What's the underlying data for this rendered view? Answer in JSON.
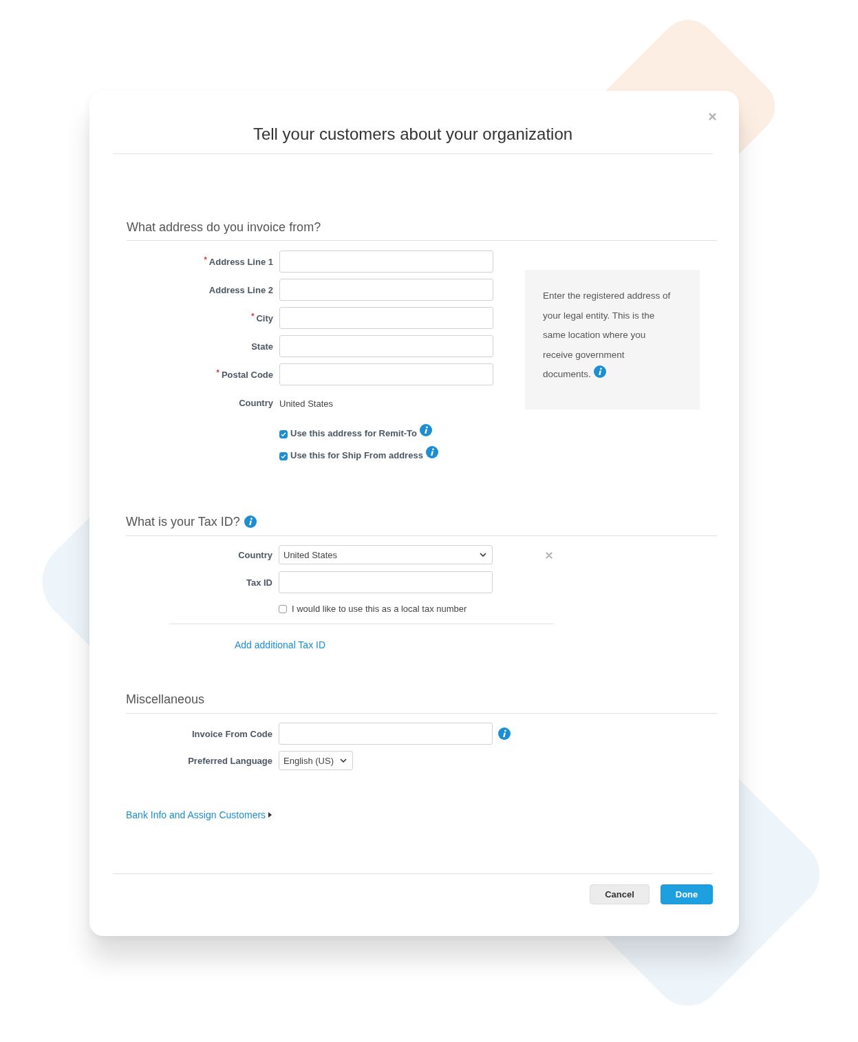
{
  "dialog": {
    "title": "Tell your customers about your organization",
    "address": {
      "heading": "What address do you invoice from?",
      "fields": [
        {
          "label": "Address Line 1",
          "required_mark": "*",
          "kind": "input"
        },
        {
          "label": "Address Line 2",
          "kind": "input"
        },
        {
          "label": "City",
          "required_mark": "*",
          "kind": "input"
        },
        {
          "label": "State",
          "kind": "input"
        },
        {
          "label": "Postal Code",
          "required_mark": "*",
          "kind": "input"
        },
        {
          "label": "Country",
          "kind": "text",
          "value": "United States"
        }
      ],
      "checkboxes": [
        {
          "label": "Use this address for Remit-To",
          "checked": true,
          "info": true
        },
        {
          "label": "Use this for Ship From address",
          "checked": true,
          "info": true
        }
      ],
      "help": {
        "text": "Enter the registered address of your legal entity. This is the same location where you receive government documents.",
        "info": true
      }
    },
    "tax": {
      "heading": "What is your Tax ID?",
      "info": true,
      "fields": [
        {
          "label": "Country",
          "kind": "select",
          "value": "United States",
          "removable": true
        },
        {
          "label": "Tax ID",
          "kind": "input"
        }
      ],
      "local_checkbox": {
        "label": "I would like to use this as a local tax number",
        "checked": false
      },
      "add_link": "Add additional Tax ID"
    },
    "misc": {
      "heading": "Miscellaneous",
      "fields": [
        {
          "label": "Invoice From Code",
          "kind": "input",
          "info": true
        },
        {
          "label": "Preferred Language",
          "kind": "select",
          "value": "English (US)",
          "compact": true
        }
      ]
    },
    "bank_link": "Bank Info and Assign Customers",
    "buttons": [
      {
        "label": "Cancel",
        "kind": "secondary"
      },
      {
        "label": "Done",
        "kind": "primary"
      }
    ]
  }
}
